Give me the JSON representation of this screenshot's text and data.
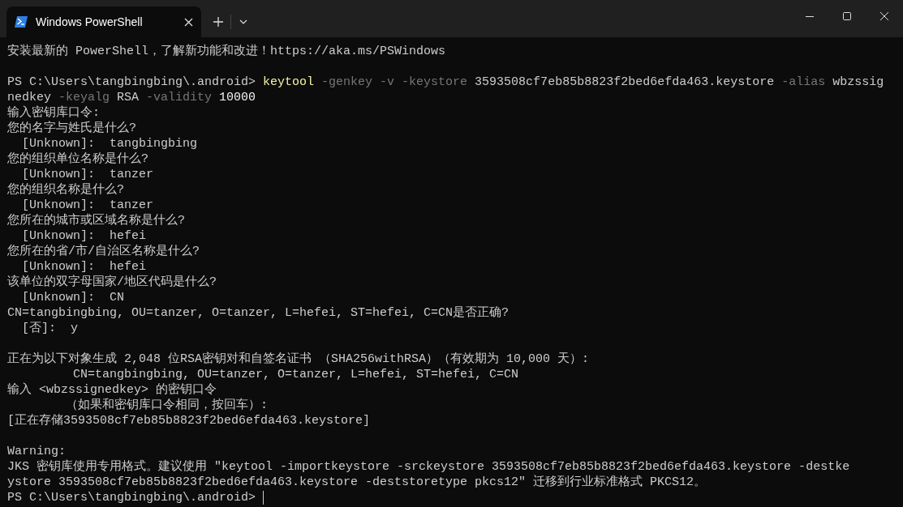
{
  "tab": {
    "title": "Windows PowerShell",
    "selected": true
  },
  "lines": [
    {
      "kind": "text",
      "segments": [
        {
          "kind": "plain",
          "text": "安装最新的 PowerShell，了解新功能和改进！https://aka.ms/PSWindows"
        }
      ]
    },
    {
      "kind": "blank"
    },
    {
      "kind": "text",
      "segments": [
        {
          "kind": "plain",
          "text": "PS C:\\Users\\tangbingbing\\.android> "
        },
        {
          "kind": "command",
          "text": "keytool"
        },
        {
          "kind": "param",
          "text": " -genkey -v -keystore"
        },
        {
          "kind": "plain",
          "text": " 3593508cf7eb85b8823f2bed6efda463.keystore"
        },
        {
          "kind": "param",
          "text": " -alias"
        },
        {
          "kind": "plain",
          "text": " wbzssig"
        }
      ]
    },
    {
      "kind": "text",
      "segments": [
        {
          "kind": "plain",
          "text": "nedkey"
        },
        {
          "kind": "param",
          "text": " -keyalg"
        },
        {
          "kind": "plain",
          "text": " RSA"
        },
        {
          "kind": "param",
          "text": " -validity"
        },
        {
          "kind": "number",
          "text": " 10000"
        }
      ]
    },
    {
      "kind": "text",
      "segments": [
        {
          "kind": "plain",
          "text": "输入密钥库口令:"
        }
      ]
    },
    {
      "kind": "text",
      "segments": [
        {
          "kind": "plain",
          "text": "您的名字与姓氏是什么?"
        }
      ]
    },
    {
      "kind": "text",
      "segments": [
        {
          "kind": "plain",
          "text": "  [Unknown]:  tangbingbing"
        }
      ]
    },
    {
      "kind": "text",
      "segments": [
        {
          "kind": "plain",
          "text": "您的组织单位名称是什么?"
        }
      ]
    },
    {
      "kind": "text",
      "segments": [
        {
          "kind": "plain",
          "text": "  [Unknown]:  tanzer"
        }
      ]
    },
    {
      "kind": "text",
      "segments": [
        {
          "kind": "plain",
          "text": "您的组织名称是什么?"
        }
      ]
    },
    {
      "kind": "text",
      "segments": [
        {
          "kind": "plain",
          "text": "  [Unknown]:  tanzer"
        }
      ]
    },
    {
      "kind": "text",
      "segments": [
        {
          "kind": "plain",
          "text": "您所在的城市或区域名称是什么?"
        }
      ]
    },
    {
      "kind": "text",
      "segments": [
        {
          "kind": "plain",
          "text": "  [Unknown]:  hefei"
        }
      ]
    },
    {
      "kind": "text",
      "segments": [
        {
          "kind": "plain",
          "text": "您所在的省/市/自治区名称是什么?"
        }
      ]
    },
    {
      "kind": "text",
      "segments": [
        {
          "kind": "plain",
          "text": "  [Unknown]:  hefei"
        }
      ]
    },
    {
      "kind": "text",
      "segments": [
        {
          "kind": "plain",
          "text": "该单位的双字母国家/地区代码是什么?"
        }
      ]
    },
    {
      "kind": "text",
      "segments": [
        {
          "kind": "plain",
          "text": "  [Unknown]:  CN"
        }
      ]
    },
    {
      "kind": "text",
      "segments": [
        {
          "kind": "plain",
          "text": "CN=tangbingbing, OU=tanzer, O=tanzer, L=hefei, ST=hefei, C=CN是否正确?"
        }
      ]
    },
    {
      "kind": "text",
      "segments": [
        {
          "kind": "plain",
          "text": "  [否]:  y"
        }
      ]
    },
    {
      "kind": "blank"
    },
    {
      "kind": "text",
      "segments": [
        {
          "kind": "plain",
          "text": "正在为以下对象生成 2,048 位RSA密钥对和自签名证书 （SHA256withRSA）（有效期为 10,000 天）:"
        }
      ]
    },
    {
      "kind": "text",
      "segments": [
        {
          "kind": "plain",
          "text": "         CN=tangbingbing, OU=tanzer, O=tanzer, L=hefei, ST=hefei, C=CN"
        }
      ]
    },
    {
      "kind": "text",
      "segments": [
        {
          "kind": "plain",
          "text": "输入 <wbzssignedkey> 的密钥口令"
        }
      ]
    },
    {
      "kind": "text",
      "segments": [
        {
          "kind": "plain",
          "text": "        （如果和密钥库口令相同，按回车）:"
        }
      ]
    },
    {
      "kind": "text",
      "segments": [
        {
          "kind": "plain",
          "text": "[正在存储3593508cf7eb85b8823f2bed6efda463.keystore]"
        }
      ]
    },
    {
      "kind": "blank"
    },
    {
      "kind": "text",
      "segments": [
        {
          "kind": "plain",
          "text": "Warning:"
        }
      ]
    },
    {
      "kind": "text",
      "segments": [
        {
          "kind": "plain",
          "text": "JKS 密钥库使用专用格式。建议使用 \"keytool -importkeystore -srckeystore 3593508cf7eb85b8823f2bed6efda463.keystore -destke"
        }
      ]
    },
    {
      "kind": "text",
      "segments": [
        {
          "kind": "plain",
          "text": "ystore 3593508cf7eb85b8823f2bed6efda463.keystore -deststoretype pkcs12\" 迁移到行业标准格式 PKCS12。"
        }
      ]
    },
    {
      "kind": "prompt",
      "segments": [
        {
          "kind": "plain",
          "text": "PS C:\\Users\\tangbingbing\\.android> "
        }
      ]
    }
  ]
}
